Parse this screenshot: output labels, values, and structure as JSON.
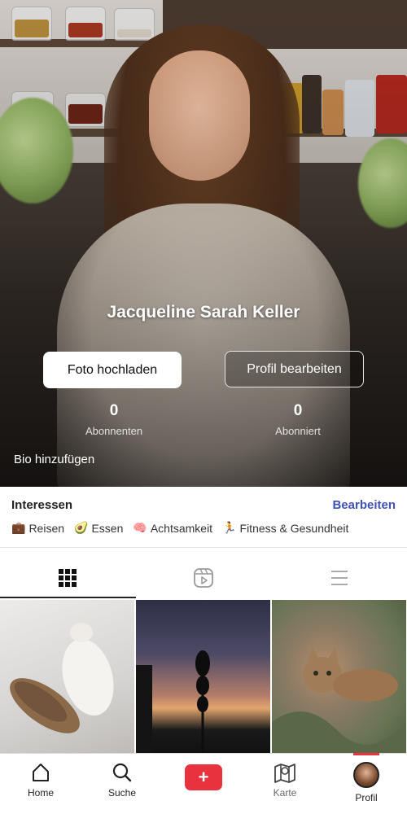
{
  "profile": {
    "name": "Jacqueline Sarah Keller",
    "upload_label": "Foto hochladen",
    "edit_label": "Profil bearbeiten",
    "followers_count": "0",
    "followers_label": "Abonnenten",
    "following_count": "0",
    "following_label": "Abonniert",
    "bio_label": "Bio hinzufügen"
  },
  "interests": {
    "title": "Interessen",
    "edit_label": "Bearbeiten",
    "items": [
      {
        "icon": "suitcase-icon",
        "glyph": "💼",
        "label": "Reisen"
      },
      {
        "icon": "avocado-icon",
        "glyph": "🥑",
        "label": "Essen"
      },
      {
        "icon": "brain-icon",
        "glyph": "🧠",
        "label": "Achtsamkeit"
      },
      {
        "icon": "running-icon",
        "glyph": "🏃",
        "label": "Fitness & Gesundheit"
      }
    ]
  },
  "tabs": [
    {
      "icon": "grid-icon",
      "active": true
    },
    {
      "icon": "video-icon",
      "active": false
    },
    {
      "icon": "list-icon",
      "active": false
    }
  ],
  "nav": {
    "home": "Home",
    "search": "Suche",
    "add": "+",
    "map": "Karte",
    "profile": "Profil",
    "active": "profile"
  },
  "colors": {
    "accent_red": "#e8333f",
    "link_blue": "#3f51b5"
  }
}
